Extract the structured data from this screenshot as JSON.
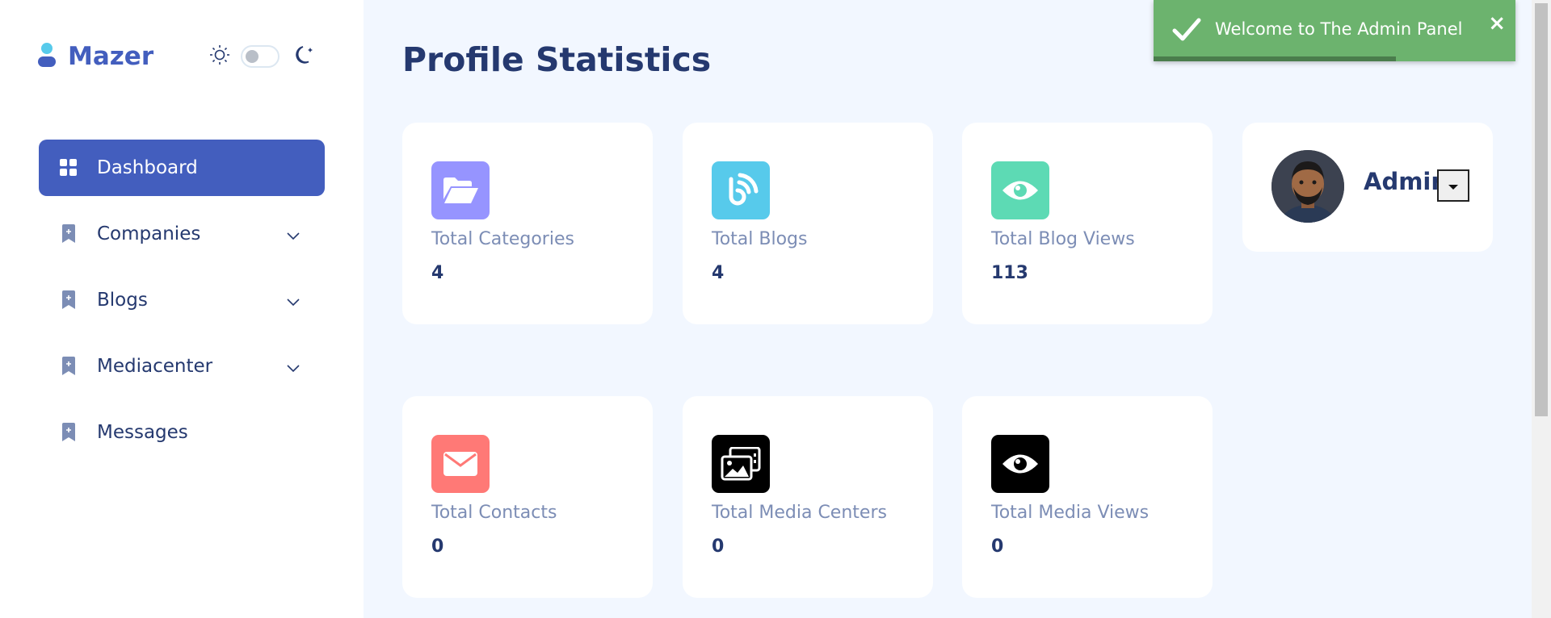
{
  "brand": {
    "name": "Mazer"
  },
  "theme": {
    "light_icon": "sun-icon",
    "dark_icon": "moon-icon",
    "dark_mode": false
  },
  "sidebar": {
    "items": [
      {
        "label": "Dashboard",
        "icon": "grid-icon",
        "active": true,
        "has_submenu": false
      },
      {
        "label": "Companies",
        "icon": "bookmark-plus-icon",
        "active": false,
        "has_submenu": true
      },
      {
        "label": "Blogs",
        "icon": "bookmark-plus-icon",
        "active": false,
        "has_submenu": true
      },
      {
        "label": "Mediacenter",
        "icon": "bookmark-plus-icon",
        "active": false,
        "has_submenu": true
      },
      {
        "label": "Messages",
        "icon": "bookmark-plus-icon",
        "active": false,
        "has_submenu": false
      }
    ]
  },
  "page": {
    "title": "Profile Statistics"
  },
  "stats": [
    {
      "label": "Total Categories",
      "value": "4",
      "icon": "folder-open-icon",
      "color": "#9694ff"
    },
    {
      "label": "Total Blogs",
      "value": "4",
      "icon": "rss-icon",
      "color": "#57caeb"
    },
    {
      "label": "Total Blog Views",
      "value": "113",
      "icon": "eye-icon",
      "color": "#5ddab4"
    },
    {
      "label": "Total Contacts",
      "value": "0",
      "icon": "envelope-icon",
      "color": "#ff7976"
    },
    {
      "label": "Total Media Centers",
      "value": "0",
      "icon": "images-icon",
      "color": "#000000"
    },
    {
      "label": "Total Media Views",
      "value": "0",
      "icon": "eye-icon",
      "color": "#000000"
    }
  ],
  "profile": {
    "name": "Admin",
    "avatar": "avatar-image"
  },
  "toast": {
    "message": "Welcome to The Admin Panel",
    "close": "×",
    "progress": 0.67
  },
  "colors": {
    "primary": "#435ebe",
    "text": "#25396f",
    "muted": "#7c8db5",
    "background": "#f2f7ff",
    "toast": "#6cb36e"
  }
}
